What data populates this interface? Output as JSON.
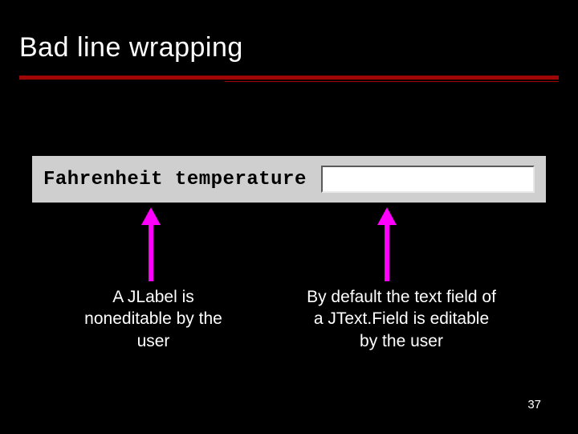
{
  "slide": {
    "title": "Bad line wrapping",
    "page_number": "37"
  },
  "component": {
    "label_text": "Fahrenheit temperature",
    "textfield_value": ""
  },
  "captions": {
    "left": "A JLabel is noneditable by the user",
    "right": "By default the text field of a JText.Field is editable by the user"
  },
  "colors": {
    "accent": "#a00606",
    "arrow": "#ff00ff"
  }
}
